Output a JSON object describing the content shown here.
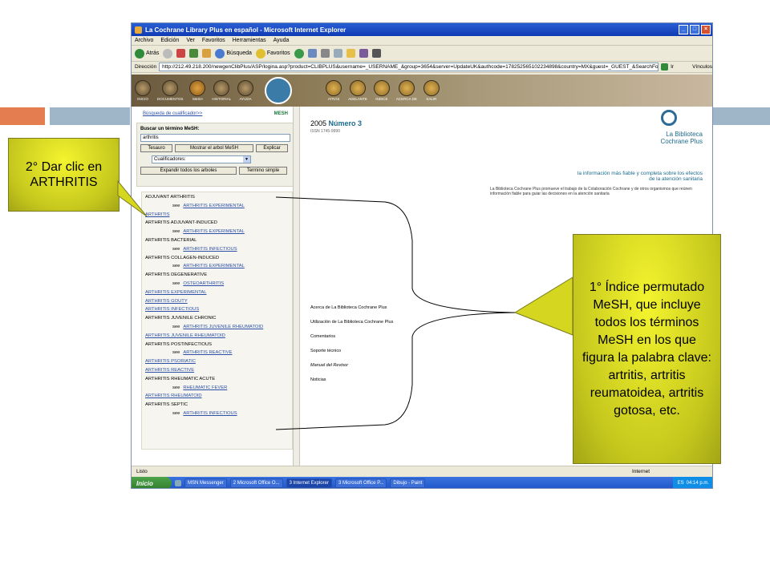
{
  "window": {
    "title": "La Cochrane Library Plus en español - Microsoft Internet Explorer"
  },
  "menubar": [
    "Archivo",
    "Edición",
    "Ver",
    "Favoritos",
    "Herramientas",
    "Ayuda"
  ],
  "toolbar": {
    "back_label": "Atrás",
    "search_label": "Búsqueda",
    "favorites_label": "Favoritos"
  },
  "address": {
    "label": "Dirección",
    "url": "http://212.49.218.200/newgenClibPlus/ASP/logina.asp?product=CLIBPLUS&username=_USERNAME_&group=3654&server=UpdateUK&authcode=178252565102234898&country=MX&guest=_GUEST_&SearchFo",
    "go_label": "Ir",
    "links_label": "Vínculos"
  },
  "banner": {
    "left_nav": [
      "INICIO",
      "DOCUMENTOS",
      "MeSH",
      "HISTORIAL",
      "AYUDA"
    ],
    "right_nav": [
      "ATRÁS",
      "ADELANTE",
      "INDICE",
      "ACERCA DE",
      "SALIR"
    ]
  },
  "left_pane": {
    "qualifier_link": "Búsqueda de cualificador>>",
    "mesh_label": "MESH",
    "search_label": "Buscar un término MeSH:",
    "search_value": "arthritis",
    "btn_thesaurus": "Tesauro",
    "btn_show_tree": "Mostrar el arbol MeSH",
    "btn_explain": "Explicar",
    "qualifier_select": "Cualificadores:",
    "btn_expand": "Expandir todos los arboles",
    "btn_simple": "Termino simple",
    "terms": [
      {
        "kind": "plain",
        "text": "ADJUVANT ARTHRITIS"
      },
      {
        "kind": "see",
        "see": "see",
        "text": "ARTHRITIS EXPERIMENTAL"
      },
      {
        "kind": "link",
        "text": "ARTHRITIS"
      },
      {
        "kind": "plain",
        "text": "ARTHRITIS ADJUVANT-INDUCED"
      },
      {
        "kind": "see",
        "see": "see",
        "text": "ARTHRITIS EXPERIMENTAL"
      },
      {
        "kind": "plain",
        "text": "ARTHRITIS BACTERIAL"
      },
      {
        "kind": "see",
        "see": "see",
        "text": "ARTHRITIS INFECTIOUS"
      },
      {
        "kind": "plain",
        "text": "ARTHRITIS COLLAGEN-INDUCED"
      },
      {
        "kind": "see",
        "see": "see",
        "text": "ARTHRITIS EXPERIMENTAL"
      },
      {
        "kind": "plain",
        "text": "ARTHRITIS DEGENERATIVE"
      },
      {
        "kind": "see",
        "see": "see",
        "text": "OSTEOARTHRITIS"
      },
      {
        "kind": "link",
        "text": "ARTHRITIS EXPERIMENTAL"
      },
      {
        "kind": "link",
        "text": "ARTHRITIS GOUTY"
      },
      {
        "kind": "link",
        "text": "ARTHRITIS INFECTIOUS"
      },
      {
        "kind": "plain",
        "text": "ARTHRITIS JUVENILE CHRONIC"
      },
      {
        "kind": "see",
        "see": "see",
        "text": "ARTHRITIS JUVENILE RHEUMATOID"
      },
      {
        "kind": "link",
        "text": "ARTHRITIS JUVENILE RHEUMATOID"
      },
      {
        "kind": "plain",
        "text": "ARTHRITIS POSTINFECTIOUS"
      },
      {
        "kind": "see",
        "see": "see",
        "text": "ARTHRITIS REACTIVE"
      },
      {
        "kind": "link",
        "text": "ARTHRITIS PSORIATIC"
      },
      {
        "kind": "link",
        "text": "ARTHRITIS REACTIVE"
      },
      {
        "kind": "plain",
        "text": "ARTHRITIS RHEUMATIC ACUTE"
      },
      {
        "kind": "see",
        "see": "see",
        "text": "RHEUMATIC FEVER"
      },
      {
        "kind": "link",
        "text": "ARTHRITIS RHEUMATOID"
      },
      {
        "kind": "plain",
        "text": "ARTHRITIS SEPTIC"
      },
      {
        "kind": "see",
        "see": "see",
        "text": "ARTHRITIS INFECTIOUS"
      }
    ]
  },
  "right_pane": {
    "issue_year": "2005",
    "issue_number": "Número 3",
    "issn": "ISSN 1745-9990",
    "logo_line1": "La Biblioteca",
    "logo_line2": "Cochrane Plus",
    "tagline": "la información más fiable y completa sobre los efectos de la atención sanitaria",
    "description": "La Biblioteca Cochrane Plus promueve el trabajo de la Colaboración Cochrane y de otros organismos que reúnen información fiable para guiar las decisiones en la atención sanitaria",
    "links": [
      "Acerca de La Biblioteca Cochrane Plus",
      "Utilización de La Biblioteca Cochrane Plus",
      "Comentarios",
      "Soporte técnico",
      "Manual del Revisor",
      "Noticias"
    ]
  },
  "statusbar": {
    "left": "Listo",
    "right": "Internet"
  },
  "taskbar": {
    "start": "Inicio",
    "tasks": [
      "MSN Messenger",
      "2 Microsoft Office O...",
      "3 Internet Explorer",
      "3 Microsoft Office P...",
      "Dibujo - Paint"
    ],
    "lang": "ES",
    "clock": "04:14 p.m."
  },
  "callouts": {
    "step2": "2° Dar clic en ARTHRITIS",
    "step1": "1° Índice permutado MeSH, que incluye todos los términos MeSH en los que figura la palabra clave: artritis, artritis reumatoidea, artritis gotosa, etc."
  }
}
